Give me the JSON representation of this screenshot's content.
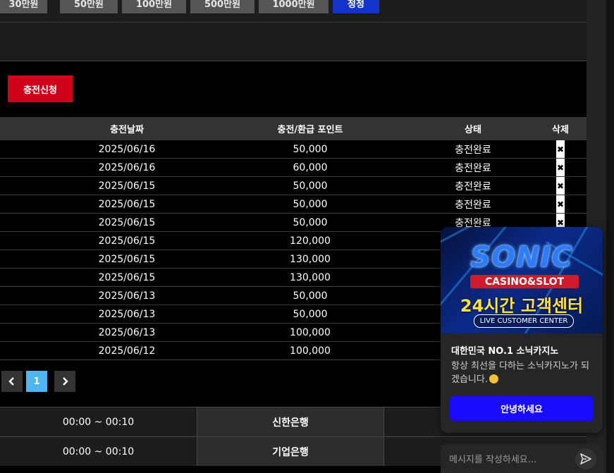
{
  "amount_buttons": [
    {
      "label": "30만원"
    },
    {
      "label": "50만원"
    },
    {
      "label": "100만원"
    },
    {
      "label": "500만원"
    },
    {
      "label": "1000만원"
    },
    {
      "label": "정정"
    }
  ],
  "apply_button": "충전신청",
  "table": {
    "headers": [
      "충전날짜",
      "충전/환급 포인트",
      "상태",
      "삭제"
    ],
    "rows": [
      {
        "date": "2025/06/16",
        "points": "50,000",
        "status": "충전완료"
      },
      {
        "date": "2025/06/16",
        "points": "60,000",
        "status": "충전완료"
      },
      {
        "date": "2025/06/15",
        "points": "50,000",
        "status": "충전완료"
      },
      {
        "date": "2025/06/15",
        "points": "50,000",
        "status": "충전완료"
      },
      {
        "date": "2025/06/15",
        "points": "50,000",
        "status": "충전완료"
      },
      {
        "date": "2025/06/15",
        "points": "120,000",
        "status": ""
      },
      {
        "date": "2025/06/15",
        "points": "130,000",
        "status": ""
      },
      {
        "date": "2025/06/15",
        "points": "130,000",
        "status": ""
      },
      {
        "date": "2025/06/13",
        "points": "50,000",
        "status": ""
      },
      {
        "date": "2025/06/13",
        "points": "50,000",
        "status": ""
      },
      {
        "date": "2025/06/13",
        "points": "100,000",
        "status": ""
      },
      {
        "date": "2025/06/12",
        "points": "100,000",
        "status": ""
      }
    ],
    "delete_glyph": "✖"
  },
  "pagination": {
    "prev": "‹",
    "current": "1",
    "next": "›"
  },
  "banks": [
    {
      "time": "00:00 ~ 00:10",
      "name": "신한은행"
    },
    {
      "time": "00:00 ~ 00:10",
      "name": "기업은행"
    }
  ],
  "chat": {
    "banner": {
      "brand": "SONIC",
      "tag": "CASINO&SLOT",
      "headline": "24시간 고객센터",
      "sub": "LIVE CUSTOMER CENTER"
    },
    "title": "대한민국 NO.1 소닉카지노",
    "message": "항상 최선을 다하는 소닉카지노가 되겠습니다.",
    "hello_button": "안녕하세요",
    "input_placeholder": "메시지를 작성하세요...",
    "icons": {
      "emoji": "smile-emoji-icon",
      "send": "send-icon"
    }
  }
}
